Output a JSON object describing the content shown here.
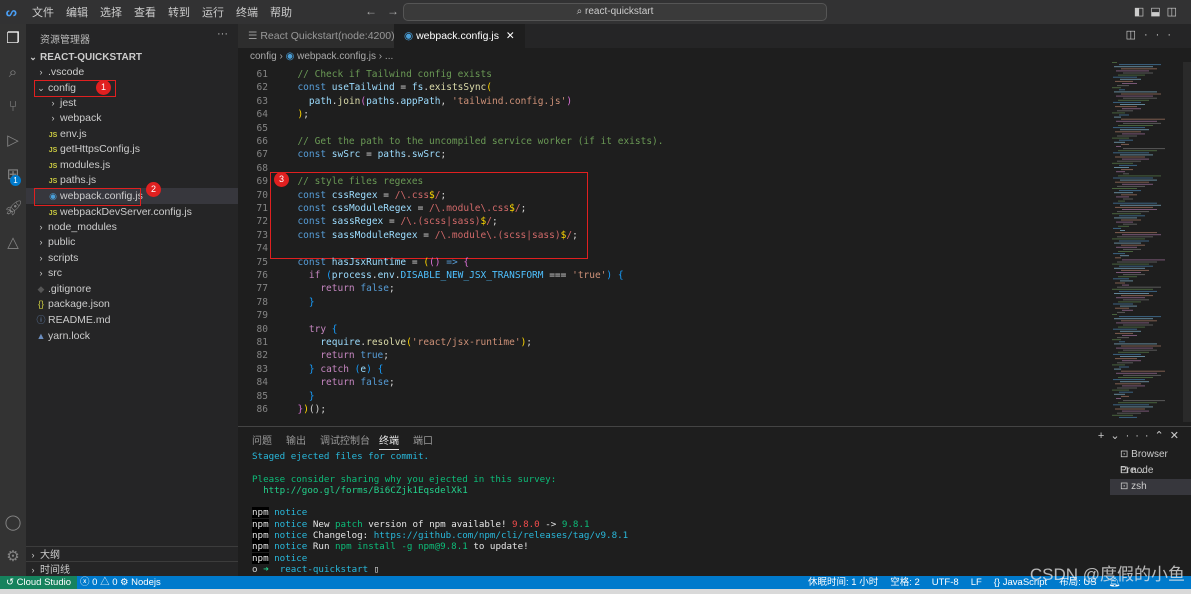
{
  "titlebar": {
    "menus": [
      "文件",
      "编辑",
      "选择",
      "查看",
      "转到",
      "运行",
      "终端",
      "帮助"
    ],
    "search": "react-quickstart",
    "layout_icons": [
      "toggle-sidebar-icon",
      "toggle-panel-icon",
      "toggle-secondary-sidebar-icon"
    ]
  },
  "sidebar": {
    "title": "资源管理器",
    "root": "REACT-QUICKSTART",
    "items": [
      {
        "label": ".vscode",
        "type": "folder",
        "depth": 0
      },
      {
        "label": "config",
        "type": "folder-open",
        "depth": 0
      },
      {
        "label": "jest",
        "type": "folder",
        "depth": 1
      },
      {
        "label": "webpack",
        "type": "folder",
        "depth": 1
      },
      {
        "label": "env.js",
        "type": "js",
        "depth": 1
      },
      {
        "label": "getHttpsConfig.js",
        "type": "js",
        "depth": 1
      },
      {
        "label": "modules.js",
        "type": "js",
        "depth": 1
      },
      {
        "label": "paths.js",
        "type": "js",
        "depth": 1
      },
      {
        "label": "webpack.config.js",
        "type": "webpack",
        "depth": 1,
        "selected": true
      },
      {
        "label": "webpackDevServer.config.js",
        "type": "js",
        "depth": 1
      },
      {
        "label": "node_modules",
        "type": "folder",
        "depth": 0
      },
      {
        "label": "public",
        "type": "folder",
        "depth": 0
      },
      {
        "label": "scripts",
        "type": "folder",
        "depth": 0
      },
      {
        "label": "src",
        "type": "folder",
        "depth": 0
      },
      {
        "label": ".gitignore",
        "type": "git",
        "depth": 0
      },
      {
        "label": "package.json",
        "type": "json",
        "depth": 0
      },
      {
        "label": "README.md",
        "type": "info",
        "depth": 0
      },
      {
        "label": "yarn.lock",
        "type": "yarn",
        "depth": 0
      }
    ],
    "outline": "大纲",
    "timeline": "时间线",
    "annotations": [
      "1",
      "2",
      "3"
    ],
    "extensions_badge": "1"
  },
  "tabs": [
    {
      "label": "React Quickstart(node:4200)",
      "active": false
    },
    {
      "label": "webpack.config.js",
      "active": true
    }
  ],
  "breadcrumb": [
    "config",
    "webpack.config.js",
    "..."
  ],
  "code": [
    {
      "n": "61",
      "t": [
        [
          "  ",
          "p"
        ],
        [
          "// Check if Tailwind config exists",
          "c"
        ]
      ]
    },
    {
      "n": "62",
      "t": [
        [
          "  ",
          "p"
        ],
        [
          "const ",
          "k"
        ],
        [
          "useTailwind",
          "v"
        ],
        [
          " = ",
          "p"
        ],
        [
          "fs",
          "v"
        ],
        [
          ".",
          "p"
        ],
        [
          "existsSync",
          "f"
        ],
        [
          "(",
          "b1"
        ]
      ]
    },
    {
      "n": "63",
      "t": [
        [
          "    ",
          "p"
        ],
        [
          "path",
          "v"
        ],
        [
          ".",
          "p"
        ],
        [
          "join",
          "f"
        ],
        [
          "(",
          "b2"
        ],
        [
          "paths",
          "v"
        ],
        [
          ".",
          "p"
        ],
        [
          "appPath",
          "v"
        ],
        [
          ", ",
          "p"
        ],
        [
          "'tailwind.config.js'",
          "s"
        ],
        [
          ")",
          "b2"
        ]
      ]
    },
    {
      "n": "64",
      "t": [
        [
          "  ",
          "p"
        ],
        [
          ")",
          "b1"
        ],
        [
          ";",
          "p"
        ]
      ]
    },
    {
      "n": "65",
      "t": []
    },
    {
      "n": "66",
      "t": [
        [
          "  ",
          "p"
        ],
        [
          "// Get the path to the uncompiled service worker (if it exists).",
          "c"
        ]
      ]
    },
    {
      "n": "67",
      "t": [
        [
          "  ",
          "p"
        ],
        [
          "const ",
          "k"
        ],
        [
          "swSrc",
          "v"
        ],
        [
          " = ",
          "p"
        ],
        [
          "paths",
          "v"
        ],
        [
          ".",
          "p"
        ],
        [
          "swSrc",
          "v"
        ],
        [
          ";",
          "p"
        ]
      ]
    },
    {
      "n": "68",
      "t": []
    },
    {
      "n": "69",
      "t": [
        [
          "  ",
          "p"
        ],
        [
          "// style files regexes",
          "c"
        ]
      ]
    },
    {
      "n": "70",
      "t": [
        [
          "  ",
          "p"
        ],
        [
          "const ",
          "k"
        ],
        [
          "cssRegex",
          "v"
        ],
        [
          " = ",
          "p"
        ],
        [
          "/\\.css",
          "r"
        ],
        [
          "$",
          "b1"
        ],
        [
          "/",
          "r"
        ],
        [
          ";",
          "p"
        ]
      ]
    },
    {
      "n": "71",
      "t": [
        [
          "  ",
          "p"
        ],
        [
          "const ",
          "k"
        ],
        [
          "cssModuleRegex",
          "v"
        ],
        [
          " = ",
          "p"
        ],
        [
          "/\\.module\\.css",
          "r"
        ],
        [
          "$",
          "b1"
        ],
        [
          "/",
          "r"
        ],
        [
          ";",
          "p"
        ]
      ]
    },
    {
      "n": "72",
      "t": [
        [
          "  ",
          "p"
        ],
        [
          "const ",
          "k"
        ],
        [
          "sassRegex",
          "v"
        ],
        [
          " = ",
          "p"
        ],
        [
          "/\\.(scss|sass)",
          "r"
        ],
        [
          "$",
          "b1"
        ],
        [
          "/",
          "r"
        ],
        [
          ";",
          "p"
        ]
      ]
    },
    {
      "n": "73",
      "t": [
        [
          "  ",
          "p"
        ],
        [
          "const ",
          "k"
        ],
        [
          "sassModuleRegex",
          "v"
        ],
        [
          " = ",
          "p"
        ],
        [
          "/\\.module\\.(scss|sass)",
          "r"
        ],
        [
          "$",
          "b1"
        ],
        [
          "/",
          "r"
        ],
        [
          ";",
          "p"
        ]
      ]
    },
    {
      "n": "74",
      "t": []
    },
    {
      "n": "75",
      "t": [
        [
          "  ",
          "p"
        ],
        [
          "const ",
          "k"
        ],
        [
          "hasJsxRuntime",
          "v"
        ],
        [
          " = ",
          "p"
        ],
        [
          "(",
          "b1"
        ],
        [
          "()",
          "b2"
        ],
        [
          " => ",
          "k"
        ],
        [
          "{",
          "b2"
        ]
      ]
    },
    {
      "n": "76",
      "t": [
        [
          "    ",
          "p"
        ],
        [
          "if ",
          "ctl"
        ],
        [
          "(",
          "b3"
        ],
        [
          "process",
          "v"
        ],
        [
          ".",
          "p"
        ],
        [
          "env",
          "v"
        ],
        [
          ".",
          "p"
        ],
        [
          "DISABLE_NEW_JSX_TRANSFORM",
          "cn"
        ],
        [
          " === ",
          "p"
        ],
        [
          "'true'",
          "s"
        ],
        [
          ")",
          "b3"
        ],
        [
          " {",
          "b3"
        ]
      ]
    },
    {
      "n": "77",
      "t": [
        [
          "      ",
          "p"
        ],
        [
          "return ",
          "ctl"
        ],
        [
          "false",
          "k"
        ],
        [
          ";",
          "p"
        ]
      ]
    },
    {
      "n": "78",
      "t": [
        [
          "    ",
          "p"
        ],
        [
          "}",
          "b3"
        ]
      ]
    },
    {
      "n": "79",
      "t": []
    },
    {
      "n": "80",
      "t": [
        [
          "    ",
          "p"
        ],
        [
          "try ",
          "ctl"
        ],
        [
          "{",
          "b3"
        ]
      ]
    },
    {
      "n": "81",
      "t": [
        [
          "      ",
          "p"
        ],
        [
          "require",
          "v"
        ],
        [
          ".",
          "p"
        ],
        [
          "resolve",
          "f"
        ],
        [
          "(",
          "b1"
        ],
        [
          "'react/jsx-runtime'",
          "s"
        ],
        [
          ")",
          "b1"
        ],
        [
          ";",
          "p"
        ]
      ]
    },
    {
      "n": "82",
      "t": [
        [
          "      ",
          "p"
        ],
        [
          "return ",
          "ctl"
        ],
        [
          "true",
          "k"
        ],
        [
          ";",
          "p"
        ]
      ]
    },
    {
      "n": "83",
      "t": [
        [
          "    ",
          "p"
        ],
        [
          "} ",
          "b3"
        ],
        [
          "catch ",
          "ctl"
        ],
        [
          "(",
          "b3"
        ],
        [
          "e",
          "v"
        ],
        [
          ")",
          "b3"
        ],
        [
          " {",
          "b3"
        ]
      ]
    },
    {
      "n": "84",
      "t": [
        [
          "      ",
          "p"
        ],
        [
          "return ",
          "ctl"
        ],
        [
          "false",
          "k"
        ],
        [
          ";",
          "p"
        ]
      ]
    },
    {
      "n": "85",
      "t": [
        [
          "    ",
          "p"
        ],
        [
          "}",
          "b3"
        ]
      ]
    },
    {
      "n": "86",
      "t": [
        [
          "  ",
          "p"
        ],
        [
          "}",
          "b2"
        ],
        [
          ")",
          "b1"
        ],
        [
          "();",
          "p"
        ]
      ]
    }
  ],
  "panel": {
    "tabs": [
      "问题",
      "输出",
      "调试控制台",
      "终端",
      "端口"
    ],
    "active_tab": "终端",
    "terminal": [
      [
        [
          "Staged ejected files for commit.",
          "cy"
        ]
      ],
      [],
      [
        [
          "Please consider sharing why you ejected in this survey:",
          "g2"
        ]
      ],
      [
        [
          "  http://goo.gl/forms/Bi6CZjk1EqsdelXk1",
          "gr"
        ]
      ],
      [],
      [
        [
          "npm",
          "nb"
        ],
        [
          " notice",
          "cy"
        ]
      ],
      [
        [
          "npm",
          "nb"
        ],
        [
          " notice ",
          "cy"
        ],
        [
          "New ",
          "wh"
        ],
        [
          "patch",
          "g2"
        ],
        [
          " version of npm available! ",
          "wh"
        ],
        [
          "9.8.0",
          "rd"
        ],
        [
          " -> ",
          "wh"
        ],
        [
          "9.8.1",
          "g2"
        ]
      ],
      [
        [
          "npm",
          "nb"
        ],
        [
          " notice ",
          "cy"
        ],
        [
          "Changelog: ",
          "wh"
        ],
        [
          "https://github.com/npm/cli/releases/tag/v9.8.1",
          "cy"
        ]
      ],
      [
        [
          "npm",
          "nb"
        ],
        [
          " notice ",
          "cy"
        ],
        [
          "Run ",
          "wh"
        ],
        [
          "npm install -g npm@9.8.1",
          "g2"
        ],
        [
          " to update!",
          "wh"
        ]
      ],
      [
        [
          "npm",
          "nb"
        ],
        [
          " notice",
          "cy"
        ]
      ],
      [
        [
          "o ",
          "p"
        ],
        [
          "➜ ",
          "gr"
        ],
        [
          " react-quickstart ",
          "cy"
        ],
        [
          "▯",
          "wh"
        ]
      ]
    ],
    "terminals": [
      "Browser Pre...",
      "node",
      "zsh"
    ],
    "selected_terminal": "zsh"
  },
  "status": {
    "remote": "Cloud Studio",
    "errors": "0",
    "warnings": "0",
    "runtime": "Nodejs",
    "right": [
      "休眠时间: 1 小时",
      "空格: 2",
      "UTF-8",
      "LF",
      "{} JavaScript",
      "布局: US"
    ]
  },
  "watermark": "CSDN @度假的小鱼",
  "colors": {
    "accent": "#007acc",
    "remote": "#16825d",
    "annotation": "#e02020"
  }
}
